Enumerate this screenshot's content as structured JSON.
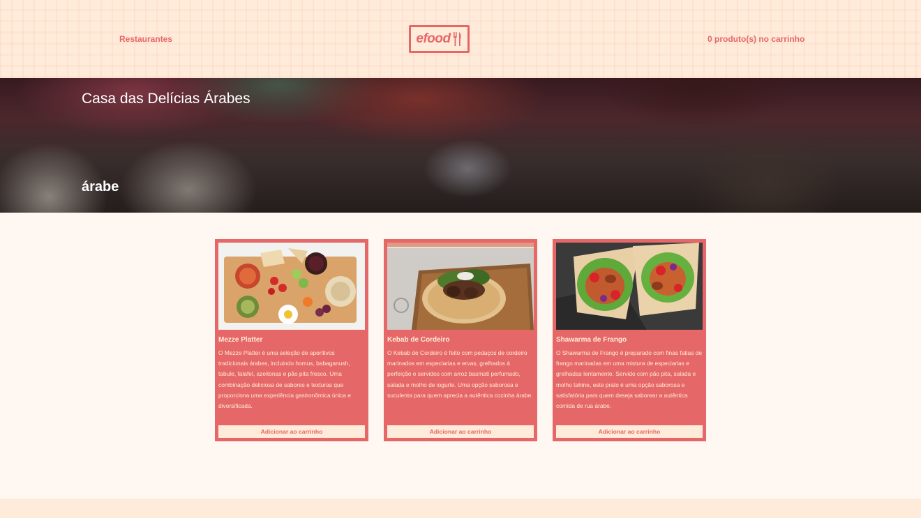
{
  "header": {
    "nav_restaurants": "Restaurantes",
    "logo_text": "efood",
    "cart_text": "0 produto(s) no carrinho"
  },
  "hero": {
    "restaurant_name": "Casa das Delícias Árabes",
    "category": "árabe"
  },
  "products": [
    {
      "title": "Mezze Platter",
      "description": "O Mezze Platter é uma seleção de aperitivos tradicionais árabes, incluindo homus, babaganush, tabule, falafel, azeitonas e pão pita fresco. Uma combinação deliciosa de sabores e texturas que proporciona uma experiência gastronômica única e diversificada.",
      "button": "Adicionar ao carrinho"
    },
    {
      "title": "Kebab de Cordeiro",
      "description": "O Kebab de Cordeiro é feito com pedaços de cordeiro marinados em especiarias e ervas, grelhados à perfeição e servidos com arroz basmati perfumado, salada e molho de iogurte. Uma opção saborosa e suculenta para quem aprecia a autêntica cozinha árabe.",
      "button": "Adicionar ao carrinho"
    },
    {
      "title": "Shawarma de Frango",
      "description": "O Shawarma de Frango é preparado com finas fatias de frango marinadas em uma mistura de especiarias e grelhadas lentamente. Servido com pão pita, salada e molho tahine, este prato é uma opção saborosa e satisfatória para quem deseja saborear a autêntica comida de rua árabe.",
      "button": "Adicionar ao carrinho"
    }
  ],
  "colors": {
    "primary": "#E66767",
    "header_bg": "#FFEBD9",
    "page_bg": "#FFF8F2",
    "card_text": "#FFEBD9"
  }
}
